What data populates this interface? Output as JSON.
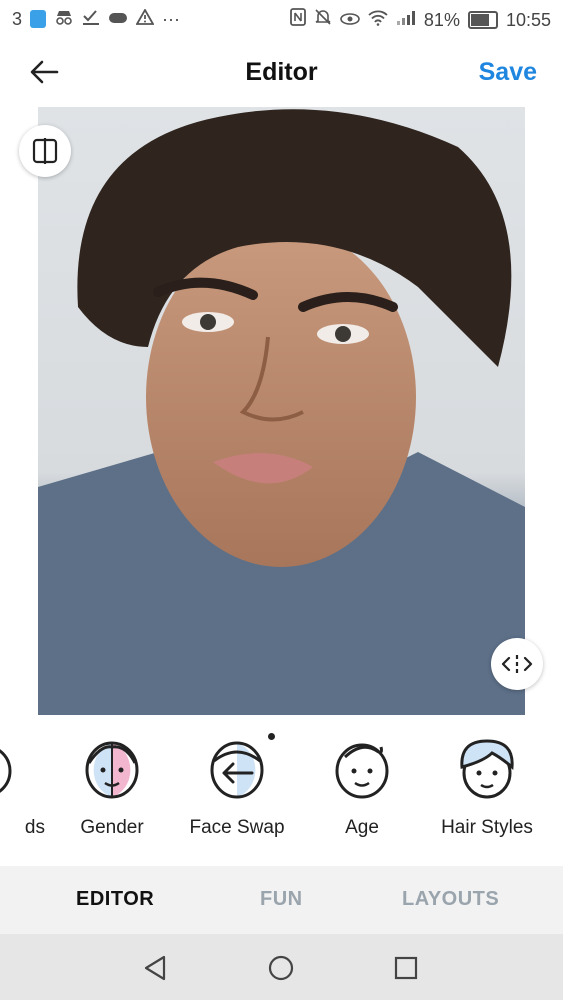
{
  "status_bar": {
    "notif_count": "3",
    "overflow": "···",
    "battery": "81%",
    "time": "10:55",
    "battery_level": 0.81
  },
  "header": {
    "title": "Editor",
    "save_label": "Save",
    "back_icon": "arrow-left-icon"
  },
  "photo": {
    "description_colors": {
      "background": "#dfe3e6",
      "shirt": "#5b6f86"
    },
    "compare_icon": "compare-icon",
    "split_icon": "split-handle-icon"
  },
  "tools": [
    {
      "label": "ds",
      "icon": "partial-icon"
    },
    {
      "label": "Gender",
      "icon": "gender-icon"
    },
    {
      "label": "Face Swap",
      "icon": "face-swap-icon"
    },
    {
      "label": "Age",
      "icon": "age-icon"
    },
    {
      "label": "Hair Styles",
      "icon": "hair-styles-icon"
    }
  ],
  "tabs": [
    {
      "label": "EDITOR",
      "active": true
    },
    {
      "label": "FUN",
      "active": false
    },
    {
      "label": "LAYOUTS",
      "active": false
    }
  ],
  "colors": {
    "accent": "#1f86e0",
    "tab_inactive": "#9aa4ad",
    "tabbar_bg": "#f2f2f2",
    "icon_blue": "#cfe3f7",
    "icon_pink": "#f3b6cf"
  }
}
